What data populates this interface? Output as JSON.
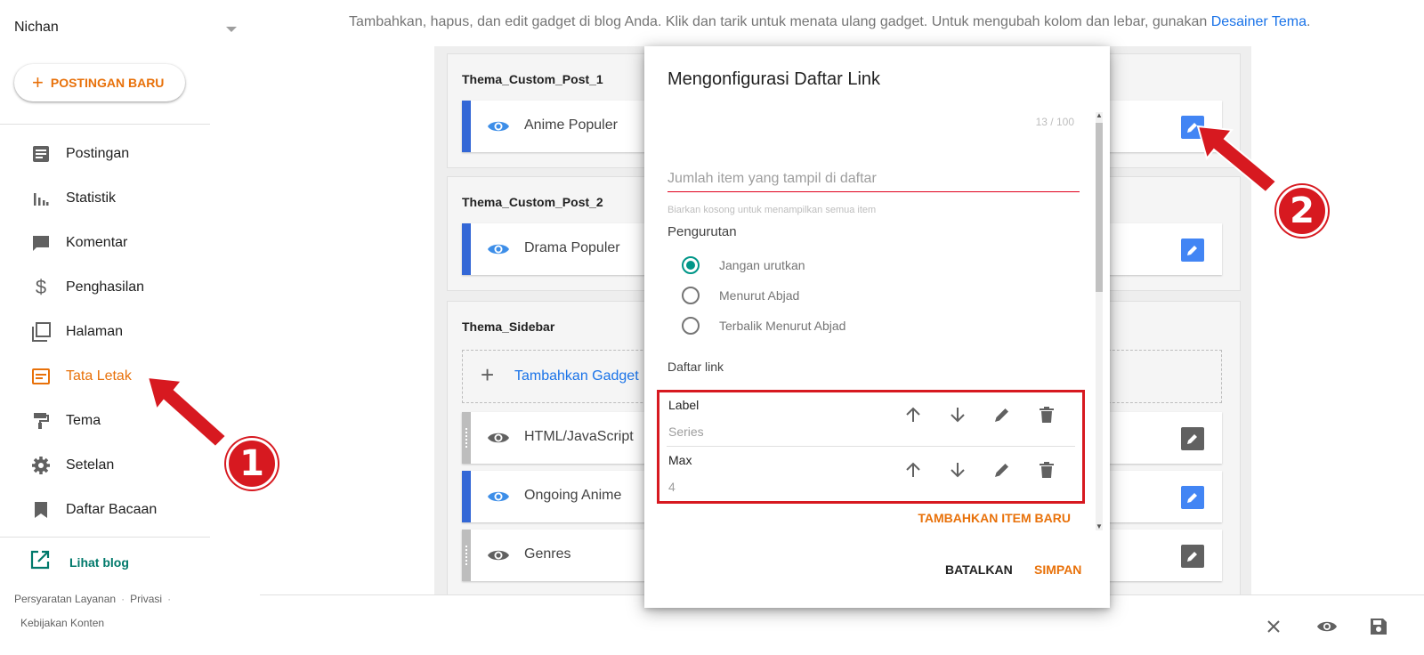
{
  "sidebar": {
    "blog_name": "Nichan",
    "new_post_label": "POSTINGAN BARU",
    "items": [
      {
        "label": "Postingan",
        "icon": "posts-icon"
      },
      {
        "label": "Statistik",
        "icon": "stats-icon"
      },
      {
        "label": "Komentar",
        "icon": "comment-icon"
      },
      {
        "label": "Penghasilan",
        "icon": "dollar-icon"
      },
      {
        "label": "Halaman",
        "icon": "pages-icon"
      },
      {
        "label": "Tata Letak",
        "icon": "layout-icon",
        "active": true
      },
      {
        "label": "Tema",
        "icon": "paint-roller-icon"
      },
      {
        "label": "Setelan",
        "icon": "gear-icon"
      },
      {
        "label": "Daftar Bacaan",
        "icon": "bookmark-icon"
      }
    ],
    "view_blog": "Lihat blog",
    "footer": {
      "terms": "Persyaratan Layanan",
      "privacy": "Privasi",
      "content_policy": "Kebijakan Konten"
    }
  },
  "main": {
    "intro": "Tambahkan, hapus, dan edit gadget di blog Anda. Klik dan tarik untuk menata ulang gadget. Untuk mengubah kolom dan lebar, gunakan",
    "intro_link": "Desainer Tema",
    "intro_end": ".",
    "sections": [
      {
        "title": "Thema_Custom_Post_1",
        "gadgets": [
          {
            "name": "Anime Populer"
          }
        ]
      },
      {
        "title": "Thema_Custom_Post_2",
        "gadgets": [
          {
            "name": "Drama Populer"
          }
        ]
      },
      {
        "title": "Thema_Sidebar",
        "add_label": "Tambahkan Gadget",
        "gadgets": [
          {
            "name": "HTML/JavaScript"
          },
          {
            "name": "Ongoing Anime"
          },
          {
            "name": "Genres"
          }
        ]
      }
    ]
  },
  "dialog": {
    "title": "Mengonfigurasi Daftar Link",
    "counter": "13 / 100",
    "field_placeholder": "Jumlah item yang tampil di daftar",
    "field_helper": "Biarkan kosong untuk menampilkan semua item",
    "sort_label": "Pengurutan",
    "sort_options": [
      "Jangan urutkan",
      "Menurut Abjad",
      "Terbalik Menurut Abjad"
    ],
    "sort_selected": "Jangan urutkan",
    "links_label": "Daftar link",
    "links": [
      {
        "name": "Label",
        "value": "Series"
      },
      {
        "name": "Max",
        "value": "4"
      }
    ],
    "add_item": "TAMBAHKAN ITEM BARU",
    "cancel": "BATALKAN",
    "save": "SIMPAN"
  },
  "annotations": {
    "marker_1": "1",
    "marker_2": "2",
    "color": "#d71920"
  },
  "colors": {
    "accent": "#e8710a",
    "link": "#1a73e8",
    "edit_blue": "#4285f4",
    "radio": "#009688"
  }
}
